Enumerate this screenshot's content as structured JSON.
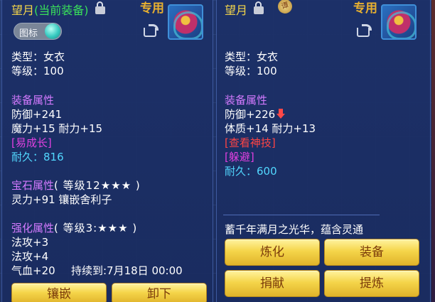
{
  "left_panel": {
    "item_name": "望月",
    "equipped_tag": "(当前装备)",
    "special_label": "专用",
    "icon_toggle_label": "图标",
    "type_line": "类型：女衣",
    "level_line": "等级：100",
    "attr_title": "装备属性",
    "attr_lines": [
      "防御+241",
      "魔力+15 耐力+15"
    ],
    "growth_tag": "[易成长]",
    "durability_label": "耐久：",
    "durability_value": "816",
    "gem_title": "宝石属性",
    "gem_level": "( 等级12★★★ )",
    "gem_line": "灵力+91 镶嵌舍利子",
    "enhance_title": "强化属性",
    "enhance_level": "( 等级3:★★★ )",
    "enhance_lines": [
      "法攻+3",
      "法攻+4"
    ],
    "hp_line": "气血+20",
    "duration_line": "持续到:7月18日 00:00",
    "buttons": [
      "镶嵌",
      "卸下"
    ]
  },
  "right_panel": {
    "item_name": "望月",
    "seal_text": "谭",
    "special_label": "专用",
    "type_line": "类型：女衣",
    "level_line": "等级：100",
    "attr_title": "装备属性",
    "attr_lines": [
      "防御+226",
      "体质+14 耐力+13"
    ],
    "check_skill": "[查看神技]",
    "dodge_tag": "[躲避]",
    "durability_label": "耐久：",
    "durability_value": "600",
    "description": "蓄千年满月之光华，蕴含灵通",
    "buttons": [
      "炼化",
      "装备",
      "捐献",
      "提炼"
    ]
  },
  "colors": {
    "gold": "#f5d64a",
    "green": "#39e05a",
    "purple": "#d47aff",
    "magenta": "#e040e0",
    "red": "#ff4444",
    "cyan": "#52d8ff"
  },
  "icons": [
    "lock-icon",
    "share-icon",
    "avatar-portrait",
    "seal-icon",
    "down-arrow-icon",
    "toggle-knob"
  ]
}
